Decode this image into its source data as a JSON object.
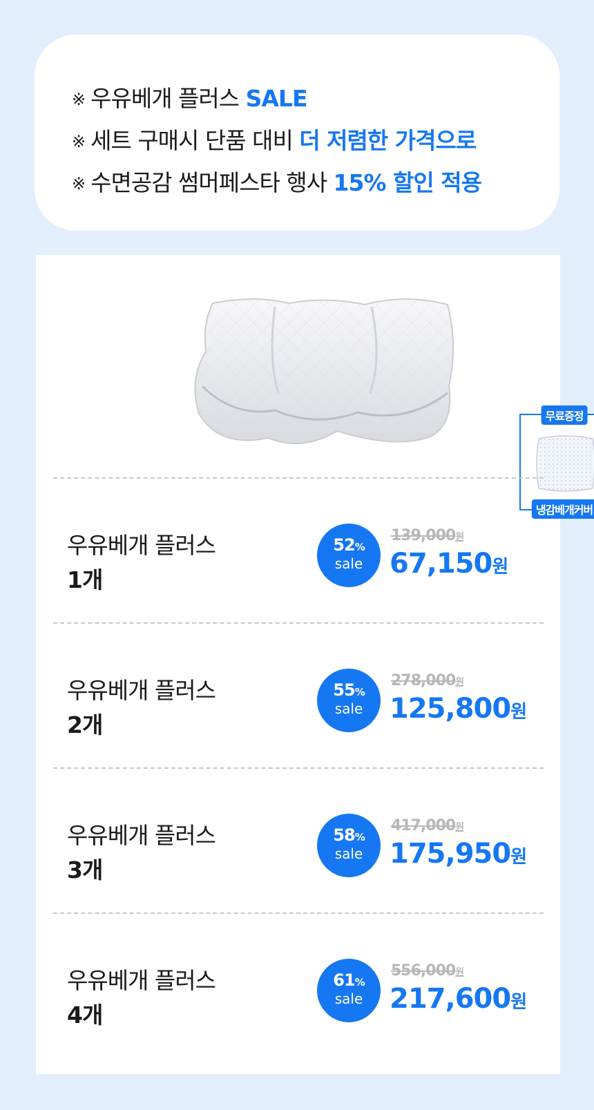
{
  "notice": {
    "mark": "※",
    "lines": [
      {
        "text": "우유베개 플러스 ",
        "highlight": "SALE"
      },
      {
        "text": "세트 구매시 단품 대비 ",
        "highlight": "더 저렴한 가격으로"
      },
      {
        "text": "수면공감 썸머페스타 행사 ",
        "highlight": "15% 할인 적용"
      }
    ]
  },
  "product": {
    "gift_title": "무료증정",
    "gift_name": "냉감베개커버"
  },
  "options": [
    {
      "name": "우유베개 플러스",
      "qty": "1개",
      "discount": "52",
      "pct_unit": "%",
      "sale": "sale",
      "original": "139,000",
      "price": "67,150",
      "won": "원"
    },
    {
      "name": "우유베개 플러스",
      "qty": "2개",
      "discount": "55",
      "pct_unit": "%",
      "sale": "sale",
      "original": "278,000",
      "price": "125,800",
      "won": "원"
    },
    {
      "name": "우유베개 플러스",
      "qty": "3개",
      "discount": "58",
      "pct_unit": "%",
      "sale": "sale",
      "original": "417,000",
      "price": "175,950",
      "won": "원"
    },
    {
      "name": "우유베개 플러스",
      "qty": "4개",
      "discount": "61",
      "pct_unit": "%",
      "sale": "sale",
      "original": "556,000",
      "price": "217,600",
      "won": "원"
    }
  ],
  "colors": {
    "accent": "#1677f2",
    "background": "#e3eefc",
    "strike": "#b7b7b7"
  }
}
